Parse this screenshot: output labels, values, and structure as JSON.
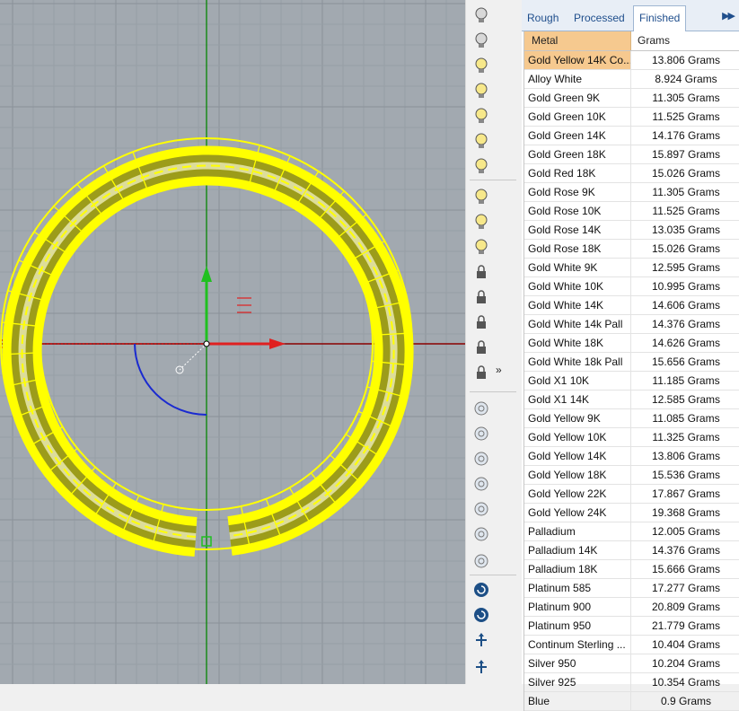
{
  "viewport": {
    "label": "Rhino viewport - ring model (top view)",
    "colors": {
      "background": "#a2a9b0",
      "grid": "#8f979f",
      "ring": "#ffff00",
      "x_axis": "#c00000",
      "y_axis": "#00b000",
      "arc": "#1a2ad0"
    }
  },
  "toolbar": {
    "more_label": "»",
    "icons": [
      "light-bulb-off-icon",
      "light-bulb-off-icon",
      "light-bulb-on-icon",
      "light-bulb-select-icon",
      "light-half-icon",
      "light-pair-icon",
      "light-pair-alt-icon",
      "light-properties-icon",
      "light-color-icon",
      "light-gradient-icon",
      "lock-icon",
      "unlock-icon",
      "lock-selected-icon",
      "lock-swap-icon",
      "lock-pair-icon",
      "gem-round-icon",
      "gem-chain-icon",
      "gem-marquise-icon",
      "gem-pave-icon",
      "gem-table-icon",
      "gem-outline-icon",
      "gem-setting-icon",
      "rotate-cw-icon",
      "rotate-ccw-icon",
      "move-up-icon",
      "move-arrows-icon"
    ]
  },
  "panel": {
    "tabs": [
      {
        "label": "Rough",
        "active": false
      },
      {
        "label": "Processed",
        "active": false
      },
      {
        "label": "Finished",
        "active": true
      }
    ],
    "tab_scroll_label": "▶▶",
    "columns": {
      "metal": "Metal",
      "grams": "Grams"
    },
    "rows": [
      {
        "metal": "Gold Yellow 14K Co...",
        "grams": "13.806 Grams",
        "selected": true
      },
      {
        "metal": "Alloy White",
        "grams": "8.924 Grams"
      },
      {
        "metal": "Gold Green 9K",
        "grams": "11.305 Grams"
      },
      {
        "metal": "Gold Green 10K",
        "grams": "11.525 Grams"
      },
      {
        "metal": "Gold Green 14K",
        "grams": "14.176 Grams"
      },
      {
        "metal": "Gold Green 18K",
        "grams": "15.897 Grams"
      },
      {
        "metal": "Gold Red 18K",
        "grams": "15.026 Grams"
      },
      {
        "metal": "Gold Rose 9K",
        "grams": "11.305 Grams"
      },
      {
        "metal": "Gold Rose 10K",
        "grams": "11.525 Grams"
      },
      {
        "metal": "Gold Rose 14K",
        "grams": "13.035 Grams"
      },
      {
        "metal": "Gold Rose 18K",
        "grams": "15.026 Grams"
      },
      {
        "metal": "Gold White 9K",
        "grams": "12.595 Grams"
      },
      {
        "metal": "Gold White 10K",
        "grams": "10.995 Grams"
      },
      {
        "metal": "Gold White 14K",
        "grams": "14.606 Grams"
      },
      {
        "metal": "Gold White 14k Pall",
        "grams": "14.376 Grams"
      },
      {
        "metal": "Gold White 18K",
        "grams": "14.626 Grams"
      },
      {
        "metal": "Gold White 18k Pall",
        "grams": "15.656 Grams"
      },
      {
        "metal": "Gold X1 10K",
        "grams": "11.185 Grams"
      },
      {
        "metal": "Gold X1 14K",
        "grams": "12.585 Grams"
      },
      {
        "metal": "Gold Yellow 9K",
        "grams": "11.085 Grams"
      },
      {
        "metal": "Gold Yellow 10K",
        "grams": "11.325 Grams"
      },
      {
        "metal": "Gold Yellow 14K",
        "grams": "13.806 Grams"
      },
      {
        "metal": "Gold Yellow 18K",
        "grams": "15.536 Grams"
      },
      {
        "metal": "Gold Yellow 22K",
        "grams": "17.867 Grams"
      },
      {
        "metal": "Gold Yellow 24K",
        "grams": "19.368 Grams"
      },
      {
        "metal": "Palladium",
        "grams": "12.005 Grams"
      },
      {
        "metal": "Palladium 14K",
        "grams": "14.376 Grams"
      },
      {
        "metal": "Palladium 18K",
        "grams": "15.666 Grams"
      },
      {
        "metal": "Platinum 585",
        "grams": "17.277 Grams"
      },
      {
        "metal": "Platinum 900",
        "grams": "20.809 Grams"
      },
      {
        "metal": "Platinum 950",
        "grams": "21.779 Grams"
      },
      {
        "metal": "Continum Sterling ...",
        "grams": "10.404 Grams"
      },
      {
        "metal": "Silver 950",
        "grams": "10.204 Grams"
      },
      {
        "metal": "Silver 925",
        "grams": "10.354 Grams"
      },
      {
        "metal": "Blue",
        "grams": "0.9 Grams"
      }
    ]
  }
}
